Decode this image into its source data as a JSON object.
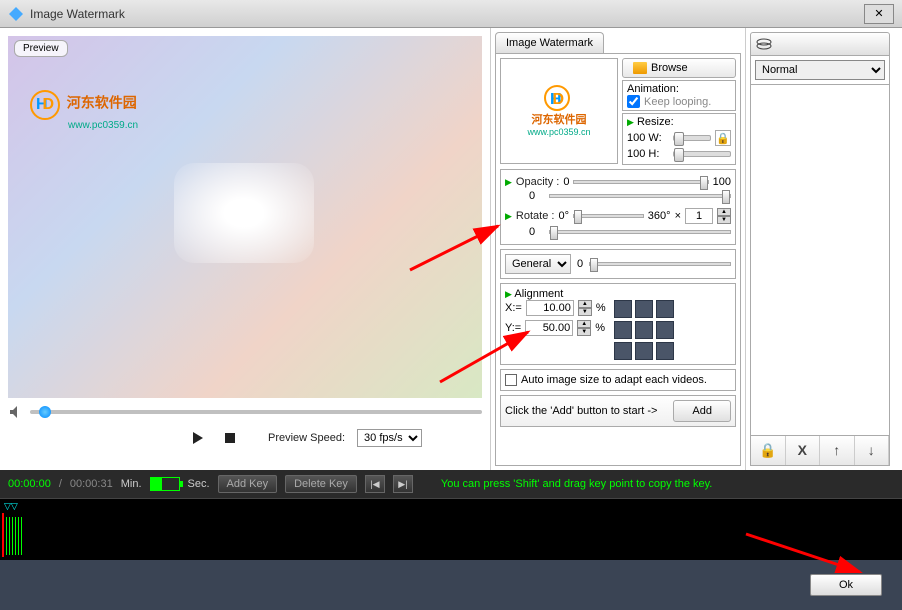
{
  "titlebar": {
    "title": "Image Watermark",
    "close": "✕"
  },
  "preview": {
    "label": "Preview",
    "watermark_text1": "河东软件园",
    "watermark_text2": "www.pc0359.cn",
    "speed_label": "Preview Speed:",
    "speed_value": "30 fps/s"
  },
  "settings": {
    "tab": "Image Watermark",
    "browse": "Browse",
    "animation_label": "Animation:",
    "keep_looping": "Keep looping.",
    "resize_label": "Resize:",
    "resize_w_label": "100 W:",
    "resize_h_label": "100  H:",
    "opacity_label": "Opacity :",
    "opacity_min": "0",
    "opacity_max": "100",
    "opacity_val": "0",
    "rotate_label": "Rotate  :",
    "rotate_min": "0°",
    "rotate_max": "360°",
    "rotate_times": "×",
    "rotate_count": "1",
    "rotate_val": "0",
    "general": "General",
    "general_val": "0",
    "alignment_label": "Alignment",
    "x_label": "X:=",
    "x_val": "10.00",
    "y_label": "Y:=",
    "y_val": "50.00",
    "pct": "%",
    "auto_label": "Auto image size to adapt each videos.",
    "add_hint": "Click the 'Add' button to start ->",
    "add_btn": "Add"
  },
  "right": {
    "mode": "Normal",
    "tool_lock": "🔒",
    "tool_del": "X",
    "tool_up": "↑",
    "tool_down": "↓"
  },
  "timeline": {
    "cur": "00:00:00",
    "sep": "/",
    "total": "00:00:31",
    "min_label": "Min.",
    "sec_label": "Sec.",
    "add_key": "Add Key",
    "del_key": "Delete Key",
    "prev": "|◀",
    "next": "▶|",
    "hint": "You can press 'Shift' and drag key point to copy the key.",
    "marker": "▽▽"
  },
  "footer": {
    "ok": "Ok"
  }
}
